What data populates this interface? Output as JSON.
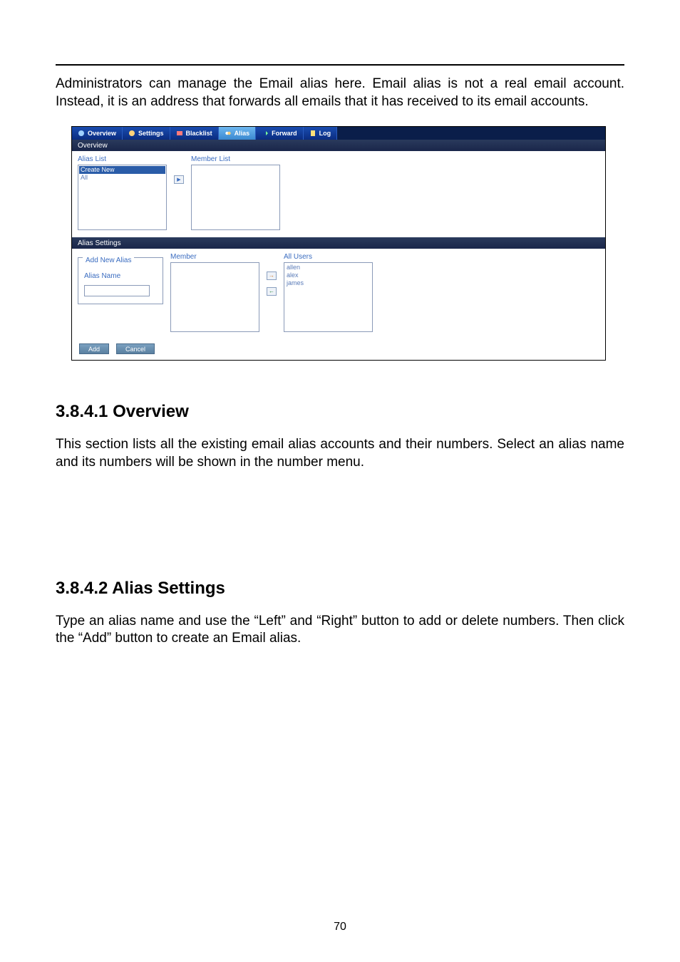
{
  "intro_text": "Administrators can manage the Email alias here. Email alias is not a real email account. Instead, it is an address that forwards all emails that it has received to its email accounts.",
  "tabs": {
    "overview": "Overview",
    "settings": "Settings",
    "blacklist": "Blacklist",
    "alias": "Alias",
    "forward": "Forward",
    "log": "Log"
  },
  "overview_section": {
    "title": "Overview",
    "alias_list_label": "Alias List",
    "member_list_label": "Member List",
    "create_new": "Create New",
    "item_all": "All"
  },
  "settings_section": {
    "title": "Alias Settings",
    "fieldset_legend": "Add New Alias",
    "alias_name_label": "Alias Name",
    "member_label": "Member",
    "all_users_label": "All Users",
    "users": [
      "allen",
      "alex",
      "james"
    ]
  },
  "buttons": {
    "add": "Add",
    "cancel": "Cancel"
  },
  "h3_overview": "3.8.4.1 Overview",
  "overview_body": "This section lists all the existing email alias accounts and their numbers. Select an alias name and its numbers will be shown in the number menu.",
  "h3_settings": "3.8.4.2 Alias Settings",
  "settings_body": "Type an alias name and use the “Left” and “Right” button to add or delete numbers. Then click the “Add” button to create an Email alias.",
  "page_number": "70"
}
